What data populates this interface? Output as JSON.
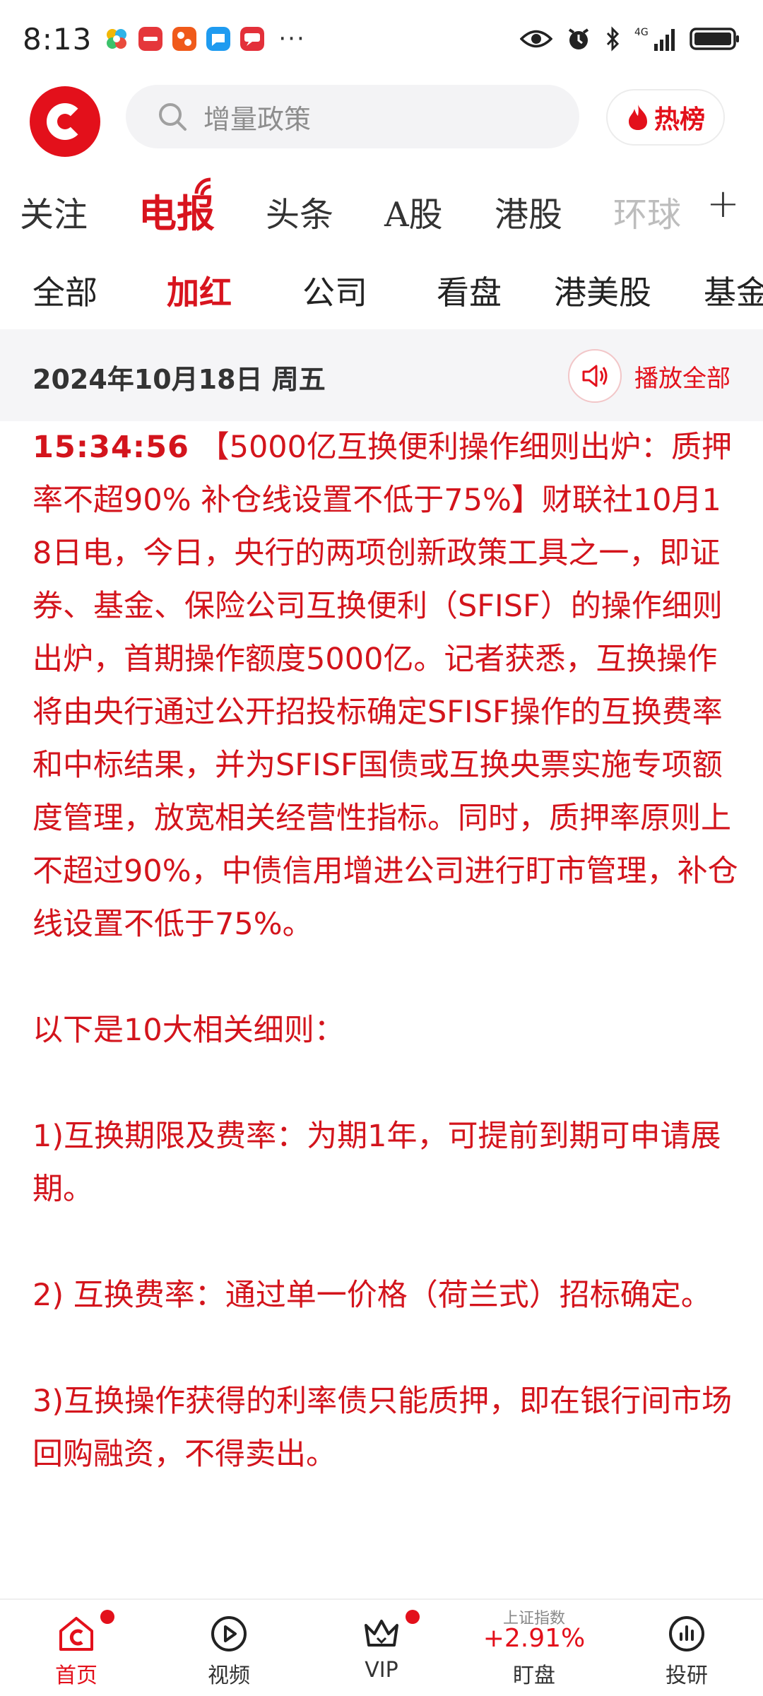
{
  "status_bar": {
    "time": "8:13",
    "dots": "···",
    "network": "4G"
  },
  "search": {
    "placeholder": "增量政策"
  },
  "hot_button": {
    "label": "热榜"
  },
  "main_tabs": [
    "关注",
    "电报",
    "头条",
    "A股",
    "港股",
    "环球"
  ],
  "sub_tabs": [
    "全部",
    "加红",
    "公司",
    "看盘",
    "港美股",
    "基金"
  ],
  "date_bar": {
    "date": "2024年10月18日 周五",
    "play_all": "播放全部"
  },
  "article": {
    "time": "15:34:56",
    "lead": "【5000亿互换便利操作细则出炉：质押率不超90% 补仓线设置不低于75%】财联社10月18日电，今日，央行的两项创新政策工具之一，即证券、基金、保险公司互换便利（SFISF）的操作细则出炉，首期操作额度5000亿。记者获悉，互换操作将由央行通过公开招投标确定SFISF操作的互换费率和中标结果，并为SFISF国债或互换央票实施专项额度管理，放宽相关经营性指标。同时，质押率原则上不超过90%，中债信用增进公司进行盯市管理，补仓线设置不低于75%。",
    "intro": "以下是10大相关细则：",
    "items": [
      "1)互换期限及费率：为期1年，可提前到期可申请展期。",
      "2) 互换费率：通过单一价格（荷兰式）招标确定。",
      "3)互换操作获得的利率债只能质押，即在银行间市场回购融资，不得卖出。"
    ]
  },
  "bottom_nav": {
    "home": "首页",
    "video": "视频",
    "vip": "VIP",
    "index_name": "上证指数",
    "index_change": "+2.91%",
    "watch": "盯盘",
    "research": "投研"
  },
  "colors": {
    "brand_red": "#e3101b",
    "article_red": "#d3141c"
  }
}
